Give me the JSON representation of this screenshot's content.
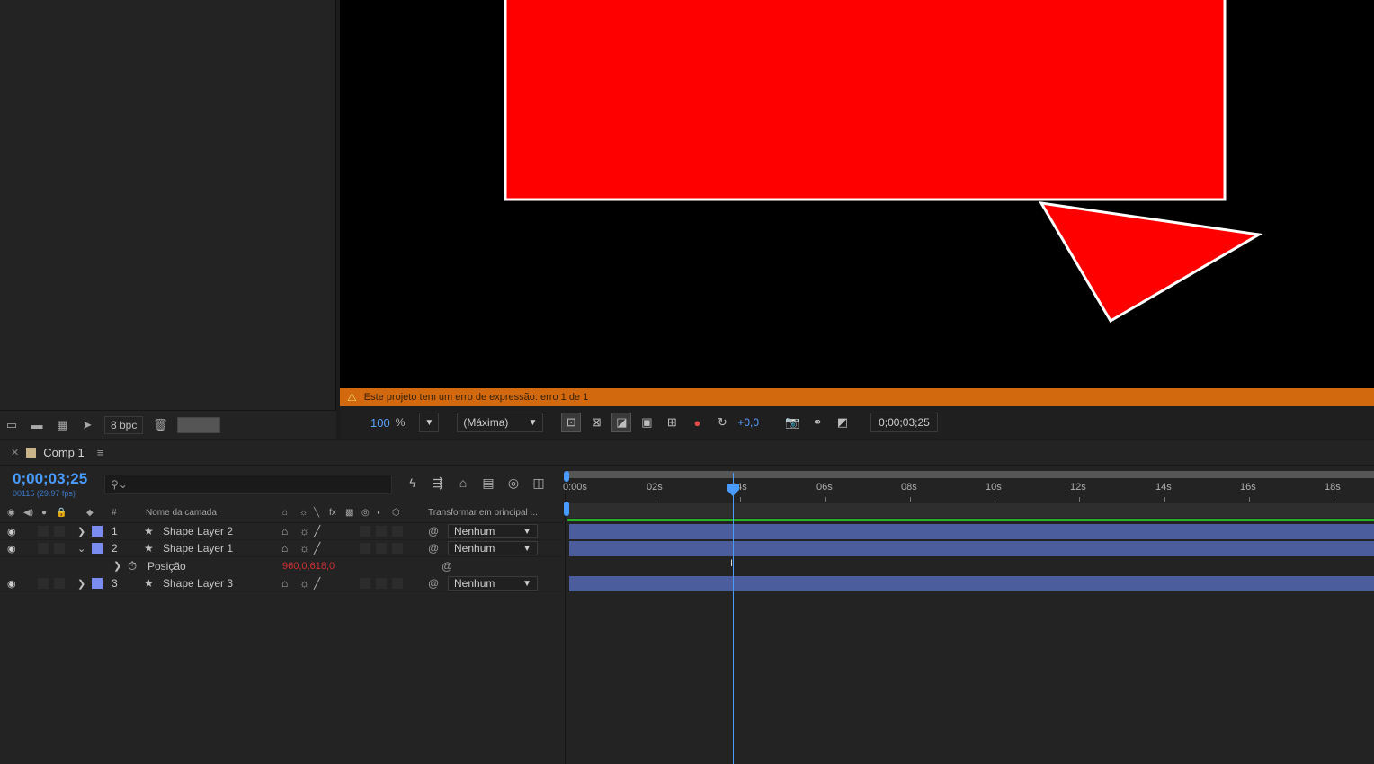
{
  "project_panel": {
    "footer": {
      "icons": [
        "interpret-footage-icon",
        "new-folder-icon",
        "new-composition-icon",
        "render-queue-icon",
        "trash-icon"
      ],
      "bpc_label": "8 bpc"
    }
  },
  "viewer": {
    "warning_text": "Este projeto tem um erro de expressão: erro 1 de 1",
    "toolbar": {
      "zoom_value": "100",
      "zoom_unit": "%",
      "resolution": "(Máxima)",
      "exposure": "+0,0",
      "timecode": "0;00;03;25"
    },
    "colors": {
      "shape_fill": "#ff0000",
      "shape_stroke": "#ffffff",
      "warning_bar": "#d2690e"
    }
  },
  "timeline": {
    "tab_label": "Comp 1",
    "current_time": "0;00;03;25",
    "frame_info": "00115 (29.97 fps)",
    "search_placeholder": "",
    "columns": {
      "layer_name": "Nome da camada",
      "number": "#",
      "parent": "Transformar em principal ..."
    },
    "layers": [
      {
        "number": "1",
        "name": "Shape Layer 2",
        "parent": "Nenhum",
        "expanded": false
      },
      {
        "number": "2",
        "name": "Shape Layer 1",
        "parent": "Nenhum",
        "expanded": true
      },
      {
        "number": "3",
        "name": "Shape Layer 3",
        "parent": "Nenhum",
        "expanded": false
      }
    ],
    "property": {
      "name": "Posição",
      "value": "960,0,618,0"
    },
    "ruler_labels": [
      "0:00s",
      "02s",
      "04s",
      "06s",
      "08s",
      "10s",
      "12s",
      "14s",
      "16s",
      "18s"
    ],
    "layer_bar_color": "#4b5d9c",
    "playhead_color": "#4a9bff"
  }
}
